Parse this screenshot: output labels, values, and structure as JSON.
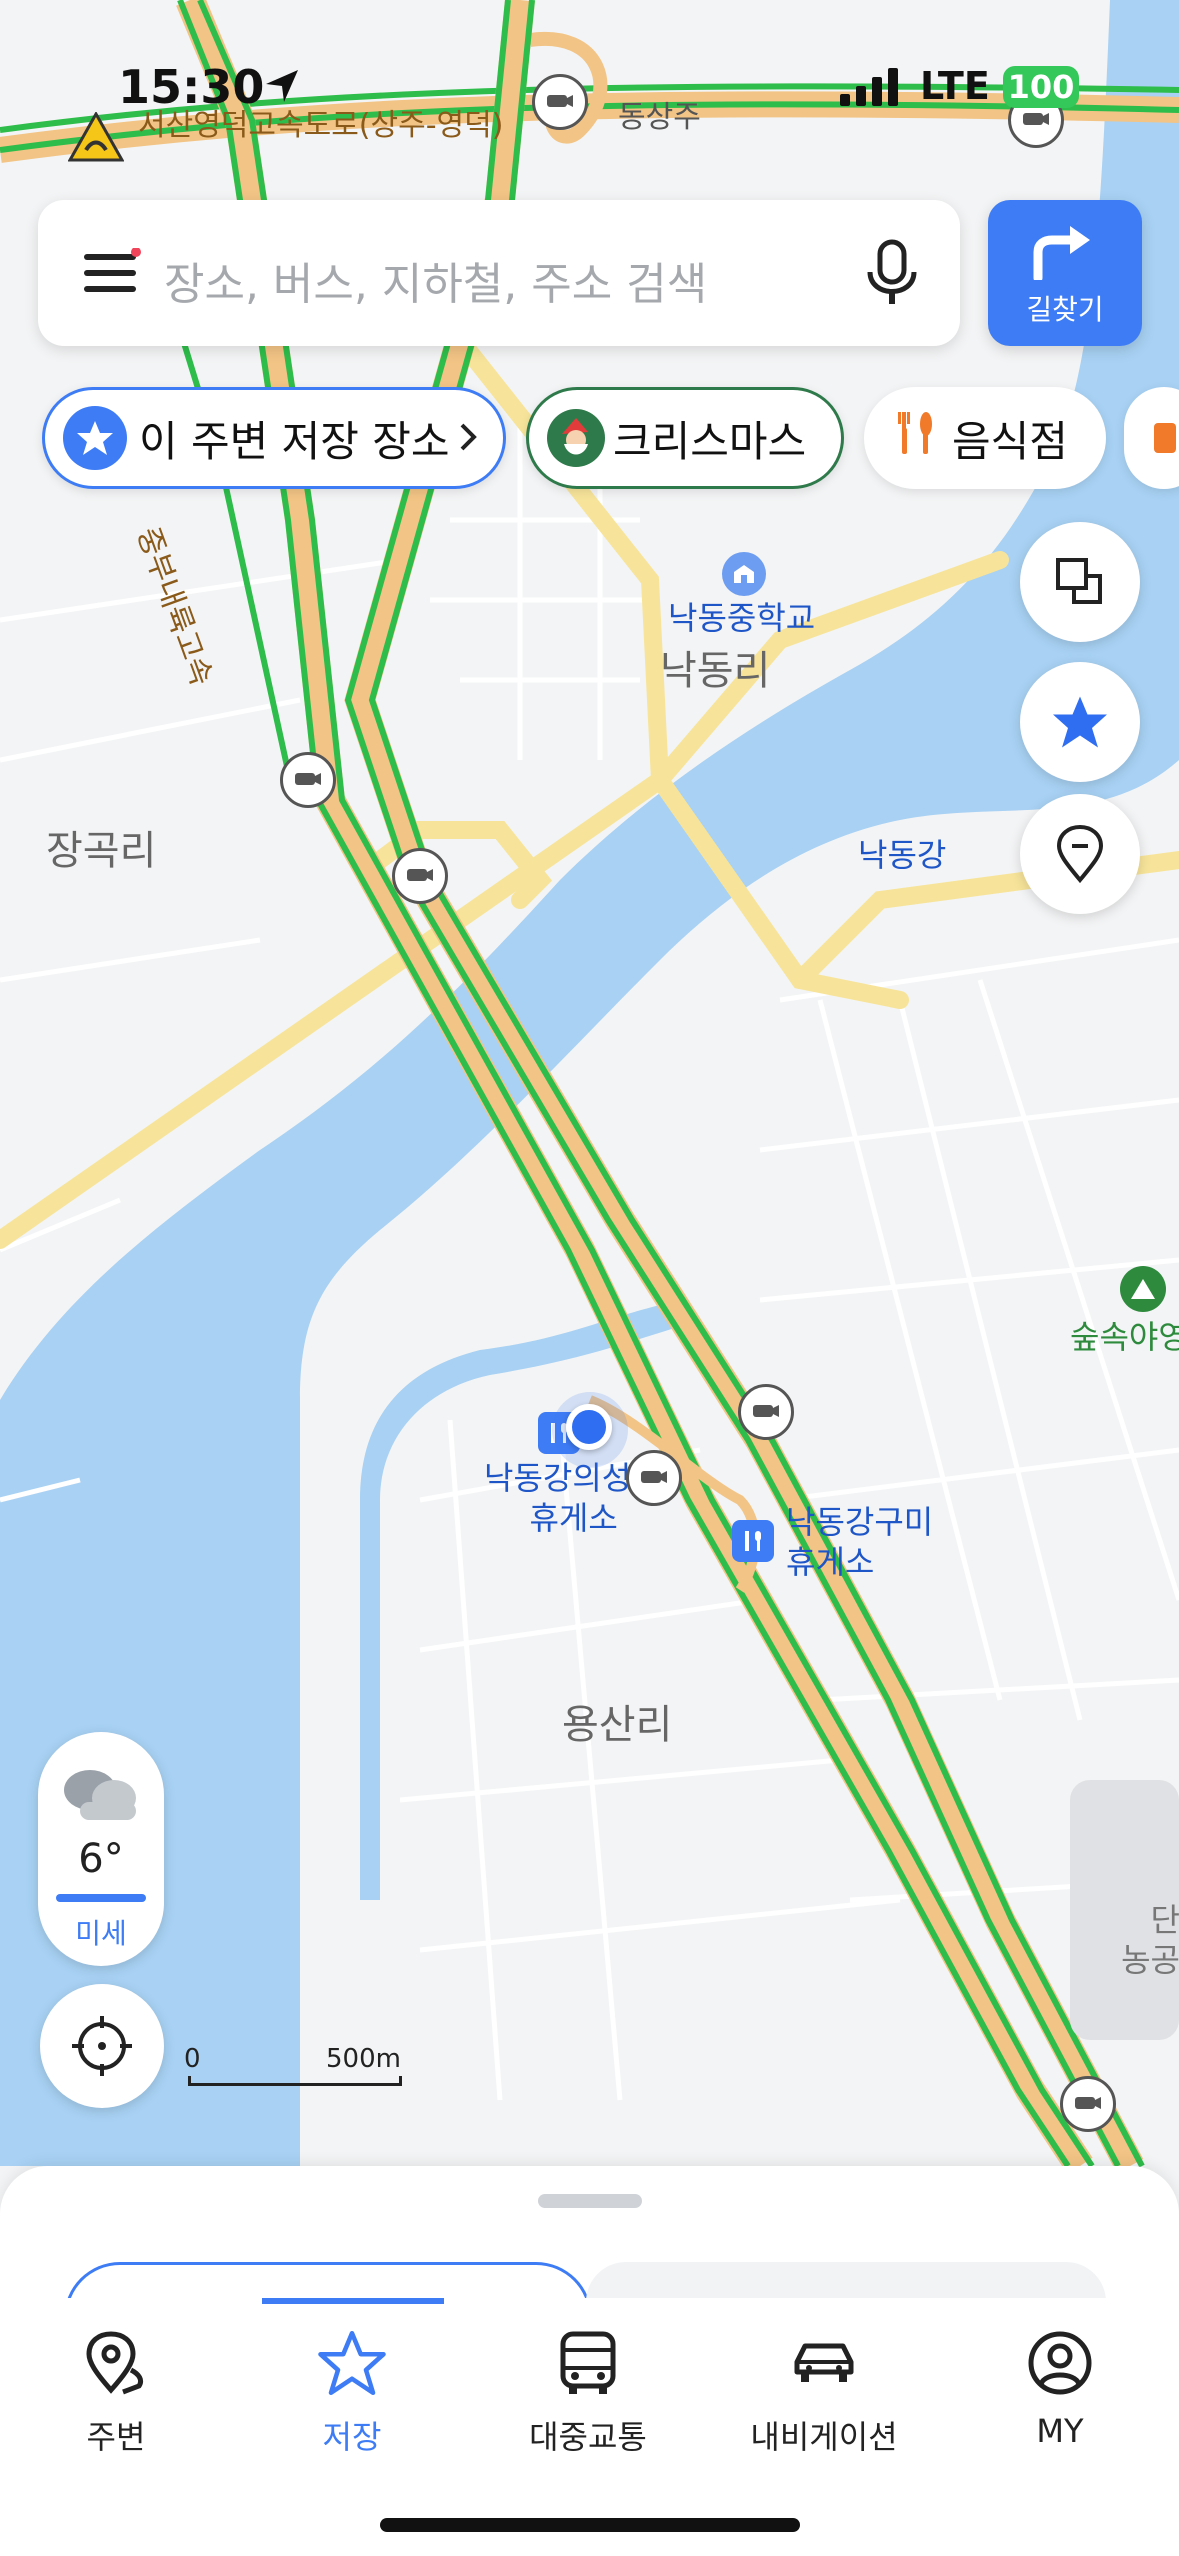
{
  "status": {
    "time": "15:30",
    "network": "LTE",
    "battery": "100"
  },
  "search": {
    "placeholder": "장소, 버스, 지하철, 주소 검색"
  },
  "route_button": {
    "label": "길찾기"
  },
  "chips": [
    {
      "label": "이 주변 저장 장소",
      "icon": "star-icon"
    },
    {
      "label": "크리스마스",
      "icon": "santa-icon"
    },
    {
      "label": "음식점",
      "icon": "fork-knife-icon"
    }
  ],
  "map_labels": {
    "highway": "서산영덕고속도로(상주-영덕)",
    "ic": "동상주",
    "highway2": "중부내륙고속",
    "school": "낙동중학교",
    "nakdongri": "낙동리",
    "janggokri": "장곡리",
    "river": "낙동강",
    "camp": "숲속야영",
    "rest1_line1": "낙동강의성",
    "rest1_line2": "휴게소",
    "rest2_line1": "낙동강구미",
    "rest2_line2": "휴게소",
    "yongsanri": "용산리",
    "edge_line1": "단",
    "edge_line2": "농공"
  },
  "weather": {
    "temp": "6°",
    "dust": "미세",
    "icon": "cloud-icon"
  },
  "scale": {
    "zero": "0",
    "distance": "500m"
  },
  "tabs": [
    {
      "label": "주변",
      "icon": "location-pin-icon",
      "active": false
    },
    {
      "label": "저장",
      "icon": "star-icon",
      "active": true
    },
    {
      "label": "대중교통",
      "icon": "bus-icon",
      "active": false
    },
    {
      "label": "내비게이션",
      "icon": "car-icon",
      "active": false
    },
    {
      "label": "MY",
      "icon": "user-icon",
      "active": false
    }
  ],
  "colors": {
    "accent": "#3d7cf5",
    "water": "#a8d1f3",
    "highway_green": "#2ebd4a",
    "road_yellow": "#f7e49a",
    "battery": "#34c759"
  }
}
